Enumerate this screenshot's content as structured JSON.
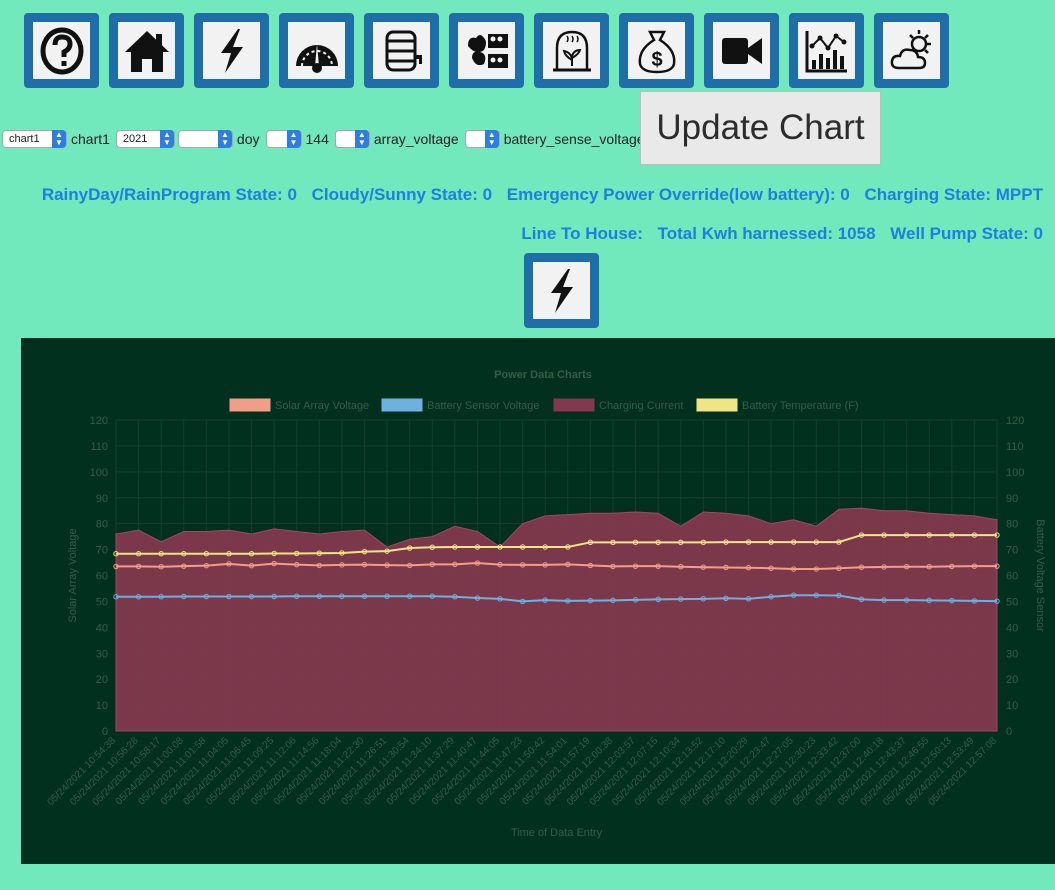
{
  "toolbar": {
    "icons": [
      {
        "name": "help-icon"
      },
      {
        "name": "home-icon"
      },
      {
        "name": "power-icon"
      },
      {
        "name": "gauge-icon"
      },
      {
        "name": "barrel-icon"
      },
      {
        "name": "chickens-eggs-icon"
      },
      {
        "name": "greenhouse-icon"
      },
      {
        "name": "money-bag-icon"
      },
      {
        "name": "video-camera-icon"
      },
      {
        "name": "statistics-icon"
      },
      {
        "name": "weather-icon"
      }
    ]
  },
  "controls": {
    "chart_select": "chart1",
    "chart_label": "chart1",
    "year_select": "2021",
    "day_select": "",
    "doy_label": "doy",
    "doy_select": "",
    "doy_value": "144",
    "series1_select": "",
    "series1_label": "array_voltage",
    "series2_select": "",
    "series2_label": "battery_sense_voltage",
    "update_button": "Update Chart"
  },
  "status": {
    "rain": "RainyDay/RainProgram State: 0",
    "cloudy": "Cloudy/Sunny State: 0",
    "emergency": "Emergency Power Override(low battery): 0",
    "charging": "Charging State: MPPT",
    "line": "Line To House:",
    "kwh": "Total Kwh harnessed: 1058",
    "pump": "Well Pump State: 0"
  },
  "colors": {
    "background": "#72e8bd",
    "chart_background": "#02301f",
    "button_blue": "#1f6ea8",
    "status_text": "#1e7fe0",
    "solar": "#f29d87",
    "battery_voltage": "#6fb0e0",
    "charging": "#82394e",
    "temperature": "#f0e585"
  },
  "chart_data": {
    "type": "line",
    "title": "Power Data Charts",
    "xlabel": "Time of Data Entry",
    "ylabel_left": "Solar Array Voltage",
    "ylabel_right": "Battery Voltage Sensor",
    "ylim": [
      0,
      120
    ],
    "yticks": [
      0,
      10,
      20,
      30,
      40,
      50,
      60,
      70,
      80,
      90,
      100,
      110,
      120
    ],
    "legend_position": "top",
    "grid": true,
    "x": [
      "05/24/2021 10:54:38",
      "05/24/2021 10:56:28",
      "05/24/2021 10:58:17",
      "05/24/2021 11:00:08",
      "05/24/2021 11:01:58",
      "05/24/2021 11:04:05",
      "05/24/2021 11:06:45",
      "05/24/2021 11:09:25",
      "05/24/2021 11:12:06",
      "05/24/2021 11:14:56",
      "05/24/2021 11:18:04",
      "05/24/2021 11:22:30",
      "05/24/2021 11:26:51",
      "05/24/2021 11:30:54",
      "05/24/2021 11:34:10",
      "05/24/2021 11:37:29",
      "05/24/2021 11:40:47",
      "05/24/2021 11:44:05",
      "05/24/2021 11:47:23",
      "05/24/2021 11:50:42",
      "05/24/2021 11:54:01",
      "05/24/2021 11:57:19",
      "05/24/2021 12:00:38",
      "05/24/2021 12:03:57",
      "05/24/2021 12:07:15",
      "05/24/2021 12:10:34",
      "05/24/2021 12:13:52",
      "05/24/2021 12:17:10",
      "05/24/2021 12:20:29",
      "05/24/2021 12:23:47",
      "05/24/2021 12:27:05",
      "05/24/2021 12:30:23",
      "05/24/2021 12:33:42",
      "05/24/2021 12:37:00",
      "05/24/2021 12:40:18",
      "05/24/2021 12:43:37",
      "05/24/2021 12:46:55",
      "05/24/2021 12:50:13",
      "05/24/2021 12:53:49",
      "05/24/2021 12:57:08"
    ],
    "series": [
      {
        "name": "Solar Array Voltage",
        "type": "line",
        "values": [
          63.5,
          63.5,
          63.4,
          63.6,
          63.8,
          64.5,
          63.8,
          64.6,
          64.2,
          63.9,
          64.1,
          64.2,
          64.0,
          63.9,
          64.3,
          64.3,
          64.8,
          64.2,
          64.1,
          64.1,
          64.3,
          63.9,
          63.5,
          63.6,
          63.6,
          63.4,
          63.2,
          63.1,
          63.0,
          62.8,
          62.5,
          62.5,
          62.8,
          63.2,
          63.3,
          63.4,
          63.4,
          63.5,
          63.6,
          63.6
        ]
      },
      {
        "name": "Battery Sensor Voltage",
        "type": "line",
        "values": [
          51.8,
          51.8,
          51.8,
          51.9,
          51.9,
          51.9,
          51.9,
          51.9,
          52.0,
          52.0,
          52.0,
          52.0,
          52.0,
          52.0,
          52.0,
          51.8,
          51.3,
          51.0,
          50.0,
          50.5,
          50.2,
          50.3,
          50.4,
          50.6,
          50.8,
          50.9,
          51.0,
          51.2,
          51.0,
          51.8,
          52.4,
          52.4,
          52.3,
          50.8,
          50.5,
          50.5,
          50.4,
          50.3,
          50.2,
          50.1
        ]
      },
      {
        "name": "Charging Current",
        "type": "area",
        "values": [
          76.0,
          77.5,
          73.0,
          77.0,
          77.0,
          77.5,
          76.0,
          78.0,
          77.0,
          76.0,
          77.0,
          77.5,
          71.0,
          74.0,
          75.0,
          79.0,
          77.0,
          71.0,
          80.0,
          83.0,
          83.5,
          84.0,
          84.0,
          84.5,
          84.0,
          79.0,
          84.5,
          84.0,
          83.0,
          80.0,
          81.5,
          79.0,
          85.5,
          86.0,
          85.0,
          85.0,
          84.0,
          83.5,
          83.0,
          81.5
        ]
      },
      {
        "name": "Battery Temperature (F)",
        "type": "line",
        "values": [
          68.4,
          68.4,
          68.4,
          68.4,
          68.4,
          68.4,
          68.4,
          68.5,
          68.5,
          68.6,
          68.7,
          69.2,
          69.4,
          70.6,
          70.9,
          71.0,
          71.0,
          71.0,
          71.0,
          71.0,
          71.0,
          72.8,
          72.8,
          72.8,
          72.8,
          72.8,
          72.8,
          72.9,
          72.9,
          72.9,
          72.9,
          72.9,
          72.9,
          75.6,
          75.6,
          75.6,
          75.6,
          75.6,
          75.6,
          75.6
        ]
      }
    ]
  }
}
